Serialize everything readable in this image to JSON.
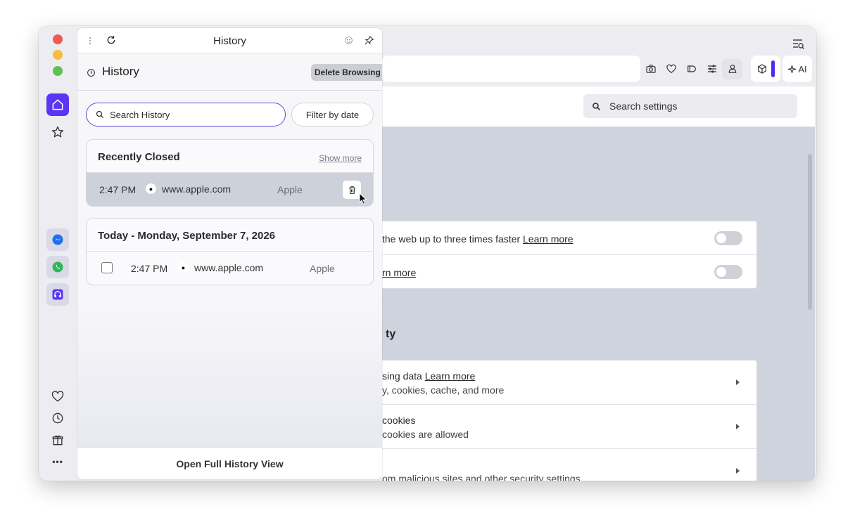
{
  "window": {
    "traffic_lights": [
      "red",
      "yellow",
      "green"
    ]
  },
  "sidebar": {
    "top_items": [
      {
        "name": "home",
        "icon": "home-icon"
      },
      {
        "name": "favorites",
        "icon": "star-icon"
      }
    ],
    "apps": [
      {
        "name": "messenger",
        "icon": "messenger-icon"
      },
      {
        "name": "whatsapp",
        "icon": "whatsapp-icon"
      },
      {
        "name": "music",
        "icon": "headphones-icon"
      }
    ],
    "bottom_items": [
      {
        "name": "bookmarks",
        "icon": "heart-icon"
      },
      {
        "name": "history",
        "icon": "clock-icon"
      },
      {
        "name": "gifts",
        "icon": "gift-icon"
      },
      {
        "name": "more",
        "icon": "more-icon",
        "label": "•••"
      }
    ]
  },
  "history_panel": {
    "topbar_title": "History",
    "title": "History",
    "delete_button": "Delete Browsing Data...",
    "search_placeholder": "Search History",
    "filter_button": "Filter by date",
    "recently_closed": {
      "title": "Recently Closed",
      "show_more": "Show more",
      "items": [
        {
          "time": "2:47 PM",
          "url": "www.apple.com",
          "page_title": "Apple"
        }
      ]
    },
    "today": {
      "title": "Today - Monday, September 7, 2026",
      "items": [
        {
          "time": "2:47 PM",
          "url": "www.apple.com",
          "page_title": "Apple"
        }
      ]
    },
    "footer_button": "Open Full History View"
  },
  "browser": {
    "toolbar_ai_label": "AI",
    "settings_search_placeholder": "Search settings",
    "rows_group1": [
      {
        "text": " the web up to three times faster ",
        "link": "Learn more"
      },
      {
        "text": "",
        "link": "rn more"
      }
    ],
    "section_title": "ty",
    "rows_group2": [
      {
        "line1": "sing data ",
        "link": "Learn more",
        "line2": "y, cookies, cache, and more"
      },
      {
        "line1": "cookies",
        "link": "",
        "line2": "cookies are allowed"
      },
      {
        "line1": "",
        "link": "",
        "line2": "om malicious sites and other security settings"
      }
    ]
  },
  "colors": {
    "accent": "#5b35f5",
    "search_border": "#5b48d9",
    "highlight_row": "#cdd1da"
  }
}
